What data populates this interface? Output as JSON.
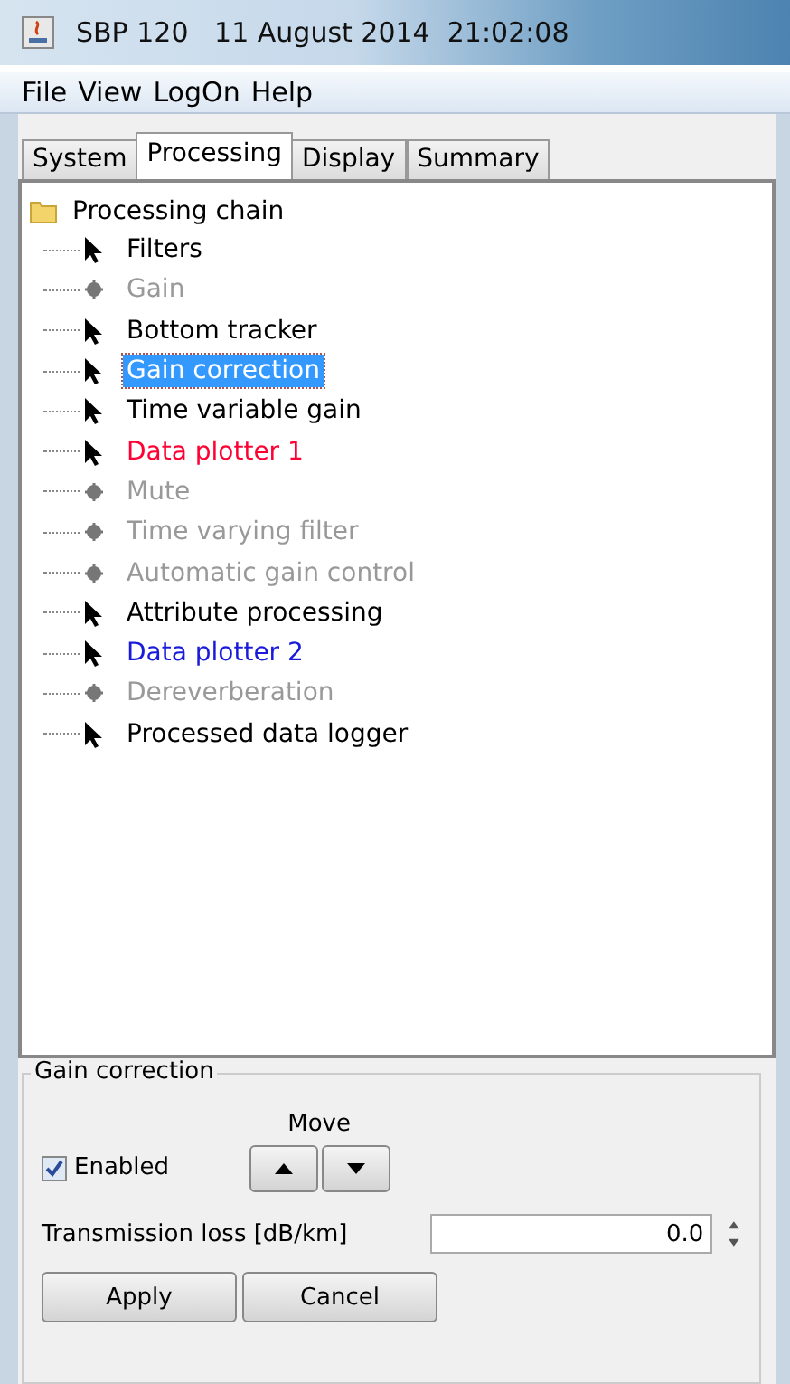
{
  "window": {
    "title": "SBP 120   11 August 2014  21:02:08"
  },
  "menu": [
    "File",
    "View",
    "LogOn",
    "Help"
  ],
  "tabs": [
    {
      "label": "System",
      "selected": false
    },
    {
      "label": "Processing",
      "selected": true
    },
    {
      "label": "Display",
      "selected": false
    },
    {
      "label": "Summary",
      "selected": false
    }
  ],
  "tree": {
    "label": "Processing chain",
    "children": [
      {
        "label": "Filters",
        "kind": "active",
        "selected": false
      },
      {
        "label": "Gain",
        "kind": "disabled",
        "selected": false
      },
      {
        "label": "Bottom tracker",
        "kind": "active",
        "selected": false
      },
      {
        "label": "Gain correction",
        "kind": "active",
        "selected": true
      },
      {
        "label": "Time variable gain",
        "kind": "active",
        "selected": false
      },
      {
        "label": "Data plotter 1",
        "kind": "active",
        "color": "#ff0033",
        "selected": false
      },
      {
        "label": "Mute",
        "kind": "disabled",
        "selected": false
      },
      {
        "label": "Time varying filter",
        "kind": "disabled",
        "selected": false
      },
      {
        "label": "Automatic gain control",
        "kind": "disabled",
        "selected": false
      },
      {
        "label": "Attribute processing",
        "kind": "active",
        "selected": false
      },
      {
        "label": "Data plotter 2",
        "kind": "active",
        "color": "#1a1adb",
        "selected": false
      },
      {
        "label": "Dereverberation",
        "kind": "disabled",
        "selected": false
      },
      {
        "label": "Processed data logger",
        "kind": "active",
        "selected": false
      }
    ]
  },
  "panel": {
    "title": "Gain correction",
    "move_label": "Move",
    "enabled": {
      "label": "Enabled",
      "checked": true
    },
    "field": {
      "label": "Transmission loss [dB/km]",
      "value": "0.0"
    },
    "buttons": [
      "Apply",
      "Cancel"
    ]
  }
}
